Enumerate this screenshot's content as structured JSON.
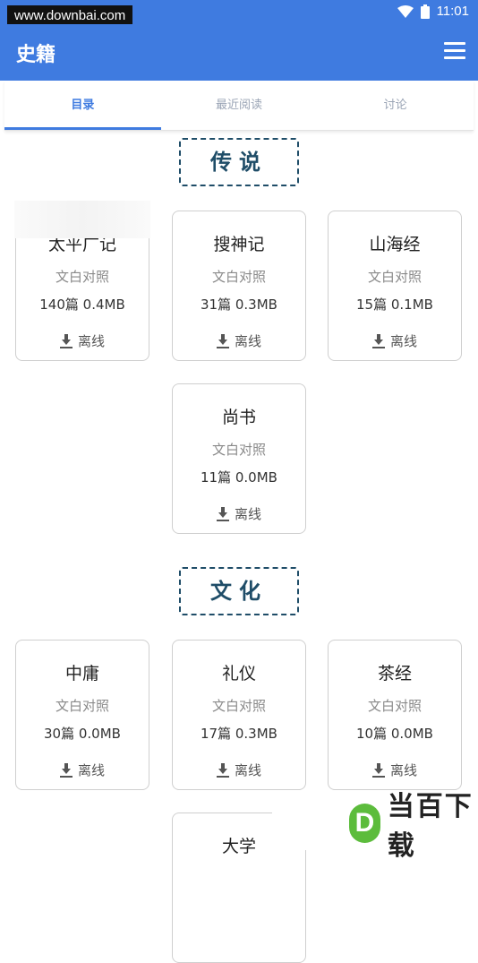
{
  "status": {
    "watermark": "www.downbai.com",
    "time": "11:01"
  },
  "app_bar": {
    "title": "史籍",
    "menu_icon": "hamburger-menu-icon"
  },
  "tabs": [
    {
      "label": "目录",
      "active": true
    },
    {
      "label": "最近阅读",
      "active": false
    },
    {
      "label": "讨论",
      "active": false
    }
  ],
  "sections": [
    {
      "title": "传说",
      "cards": [
        {
          "title": "太平广记",
          "subtitle": "文白对照",
          "meta": "140篇 0.4MB",
          "action": "离线"
        },
        {
          "title": "搜神记",
          "subtitle": "文白对照",
          "meta": "31篇 0.3MB",
          "action": "离线"
        },
        {
          "title": "山海经",
          "subtitle": "文白对照",
          "meta": "15篇 0.1MB",
          "action": "离线"
        },
        {
          "title": "尚书",
          "subtitle": "文白对照",
          "meta": "11篇 0.0MB",
          "action": "离线"
        }
      ]
    },
    {
      "title": "文化",
      "cards": [
        {
          "title": "中庸",
          "subtitle": "文白对照",
          "meta": "30篇 0.0MB",
          "action": "离线"
        },
        {
          "title": "礼仪",
          "subtitle": "文白对照",
          "meta": "17篇 0.3MB",
          "action": "离线"
        },
        {
          "title": "茶经",
          "subtitle": "文白对照",
          "meta": "10篇 0.0MB",
          "action": "离线"
        },
        {
          "title": "大学",
          "subtitle": "",
          "meta": "",
          "action": ""
        }
      ]
    }
  ],
  "watermark_bottom": {
    "logo_letter": "D",
    "text": "当百下载"
  },
  "colors": {
    "primary": "#3f7be0",
    "section_border": "#1f4d68"
  }
}
